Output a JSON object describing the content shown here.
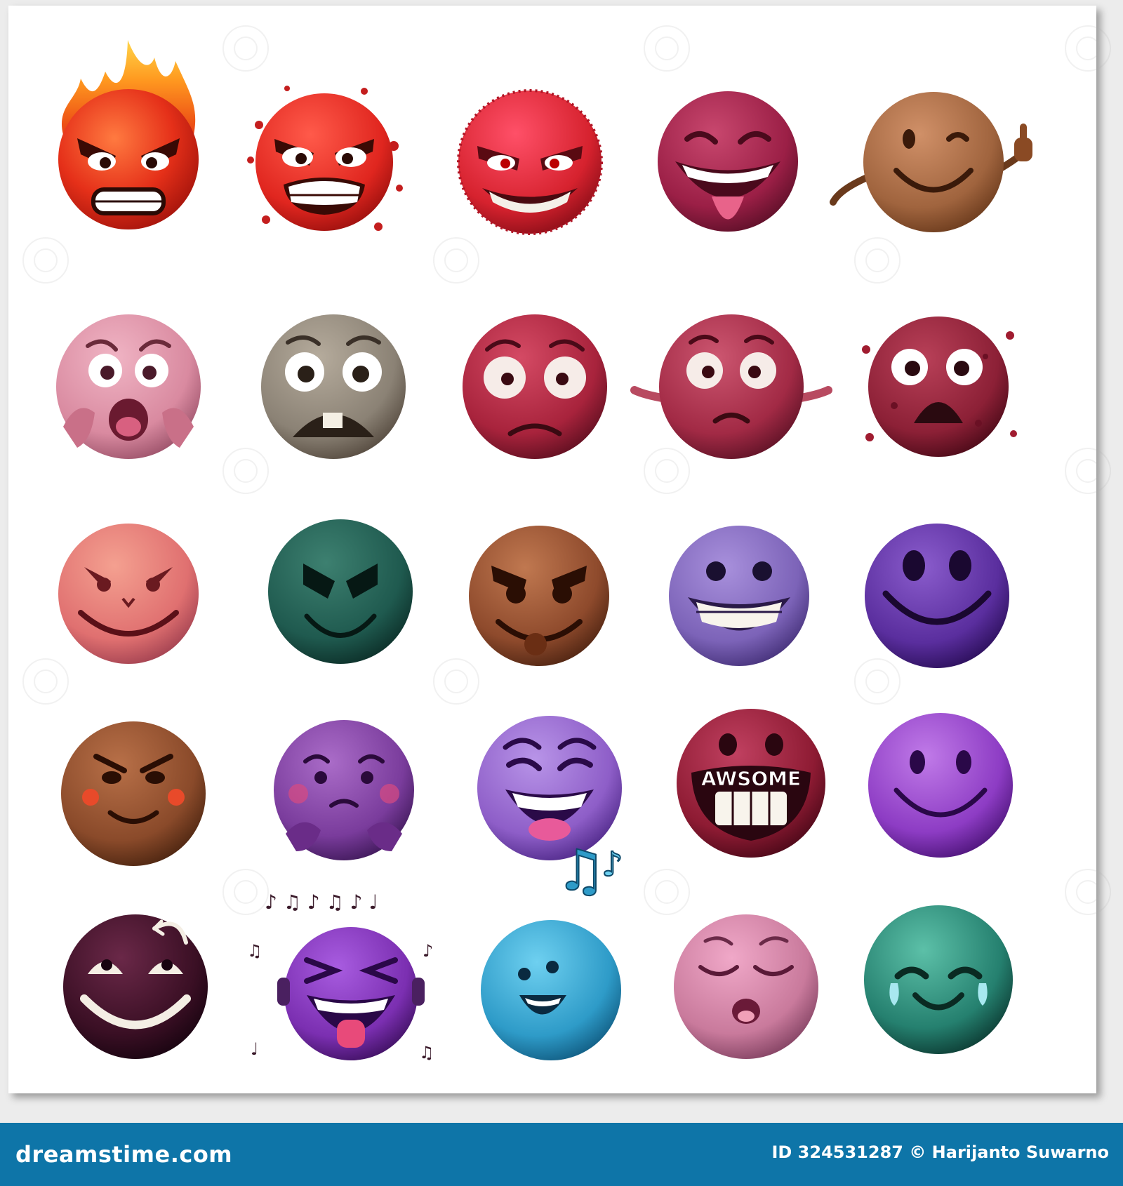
{
  "footer": {
    "brand": "dreamstime.com",
    "id_text": "ID 324531287 © Harijanto Suwarno",
    "background_color": "#0e75a8"
  },
  "sheet": {
    "emoji_count": 25,
    "rows": 5,
    "columns": 5,
    "emojis": [
      {
        "id": "fire-angry",
        "icon": "fire-angry-face-icon",
        "color": "#e53019"
      },
      {
        "id": "red-angry-splatter",
        "icon": "angry-grin-face-icon",
        "color": "#e0261f"
      },
      {
        "id": "red-devil-grin",
        "icon": "evil-grin-face-icon",
        "color": "#d6222e"
      },
      {
        "id": "maroon-tongue",
        "icon": "laughing-tongue-face-icon",
        "color": "#9b1f46"
      },
      {
        "id": "brown-thumbs-up",
        "icon": "thumbs-up-face-icon",
        "color": "#a0643e"
      },
      {
        "id": "pink-scared",
        "icon": "screaming-face-icon",
        "color": "#d98aa0"
      },
      {
        "id": "grey-scared",
        "icon": "fearful-face-icon",
        "color": "#8b8275"
      },
      {
        "id": "red-worried",
        "icon": "worried-face-icon",
        "color": "#a8233c"
      },
      {
        "id": "maroon-shrug",
        "icon": "confused-shrug-face-icon",
        "color": "#a22a45"
      },
      {
        "id": "maroon-shocked",
        "icon": "shocked-face-icon",
        "color": "#8c2036"
      },
      {
        "id": "salmon-devious",
        "icon": "devious-smile-face-icon",
        "color": "#e07070"
      },
      {
        "id": "green-evil",
        "icon": "evil-smile-face-icon",
        "color": "#1f5a4f"
      },
      {
        "id": "brown-mischief",
        "icon": "mischievous-face-icon",
        "color": "#8e4a2c"
      },
      {
        "id": "purple-grin",
        "icon": "big-grin-face-icon",
        "color": "#7c63b8"
      },
      {
        "id": "violet-smile",
        "icon": "smile-face-icon",
        "color": "#5a2e9e"
      },
      {
        "id": "brown-blush",
        "icon": "smug-blush-face-icon",
        "color": "#8a4a2a"
      },
      {
        "id": "purple-shy",
        "icon": "shy-face-icon",
        "color": "#7a3c9c"
      },
      {
        "id": "lavender-laugh",
        "icon": "laughing-face-icon",
        "color": "#8e5ec8"
      },
      {
        "id": "maroon-awesome",
        "icon": "awesome-face-icon",
        "color": "#8e1b33",
        "caption": "AWSOME"
      },
      {
        "id": "purple-smile",
        "icon": "simple-smile-face-icon",
        "color": "#8d3cc4"
      },
      {
        "id": "dark-eye-roll",
        "icon": "eye-roll-face-icon",
        "color": "#3a0f24"
      },
      {
        "id": "purple-music-laugh",
        "icon": "music-laughing-face-icon",
        "color": "#7b2fb1"
      },
      {
        "id": "blue-singing",
        "icon": "singing-face-icon",
        "color": "#2e9bc8"
      },
      {
        "id": "pink-sleepy",
        "icon": "sleepy-face-icon",
        "color": "#c97a9c"
      },
      {
        "id": "teal-tears-of-joy",
        "icon": "tears-of-joy-face-icon",
        "color": "#25806f"
      }
    ]
  }
}
